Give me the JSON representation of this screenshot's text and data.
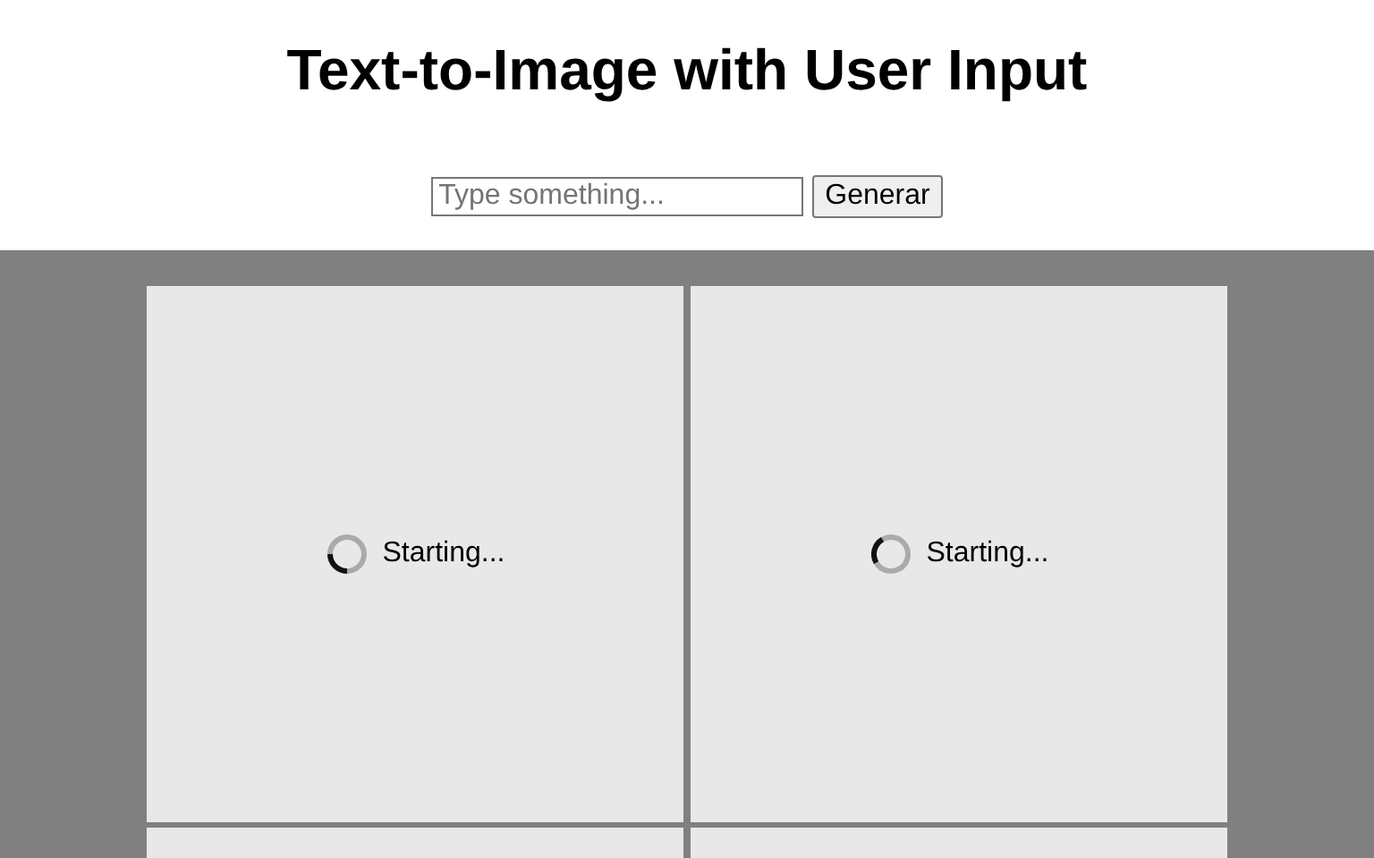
{
  "title": "Text-to-Image with User Input",
  "prompt": {
    "placeholder": "Type something...",
    "button": "Generar"
  },
  "tiles": [
    {
      "kind": "loading",
      "status": "Starting..."
    },
    {
      "kind": "loading",
      "status": "Starting..."
    },
    {
      "kind": "blank"
    },
    {
      "kind": "blank"
    }
  ]
}
